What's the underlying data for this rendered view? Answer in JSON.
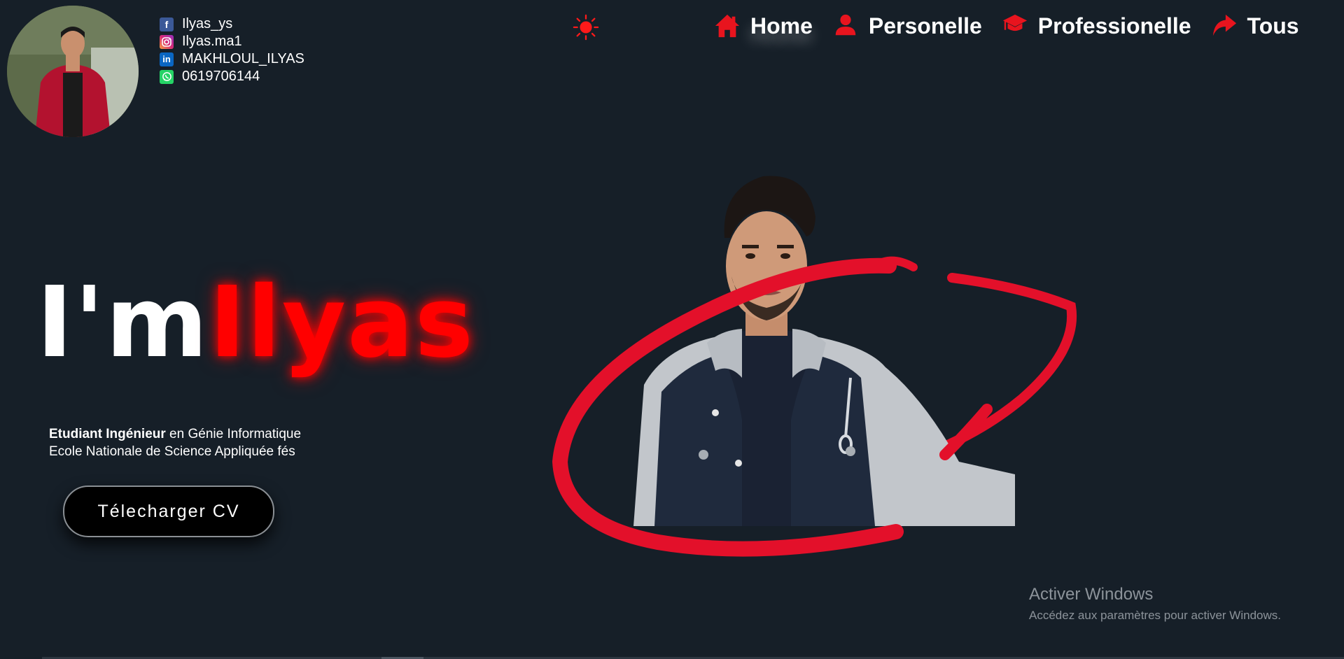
{
  "profile": {
    "photo_icon": "profile-photo"
  },
  "socials": [
    {
      "icon": "facebook-icon",
      "color": "#3b5998",
      "text": "Ilyas_ys"
    },
    {
      "icon": "instagram-icon",
      "color": "#c13584",
      "text": "Ilyas.ma1"
    },
    {
      "icon": "linkedin-icon",
      "color": "#0a66c2",
      "text": "MAKHLOUL_ILYAS"
    },
    {
      "icon": "whatsapp-icon",
      "color": "#25d366",
      "text": "0619706144"
    }
  ],
  "theme_toggle": {
    "icon": "sun-icon",
    "color": "#ff1a1a"
  },
  "nav": [
    {
      "icon": "home-icon",
      "label": "Home",
      "active": true
    },
    {
      "icon": "user-icon",
      "label": "Personelle"
    },
    {
      "icon": "graduation-cap-icon",
      "label": "Professionelle"
    },
    {
      "icon": "share-arrow-icon",
      "label": "Tous"
    }
  ],
  "hero": {
    "greeting": "I'm",
    "name": "Ilyas",
    "subtitle_strong": "Etudiant Ingénieur",
    "subtitle_rest": " en Génie Informatique",
    "subtitle_line2": "Ecole Nationale de Science Appliquée fés",
    "cv_button": "Télecharger CV",
    "photo_icon": "hero-portrait"
  },
  "watermark": {
    "title": "Activer Windows",
    "subtitle": "Accédez aux paramètres pour activer Windows."
  },
  "colors": {
    "accent": "#ff0000",
    "background": "#161f28"
  }
}
